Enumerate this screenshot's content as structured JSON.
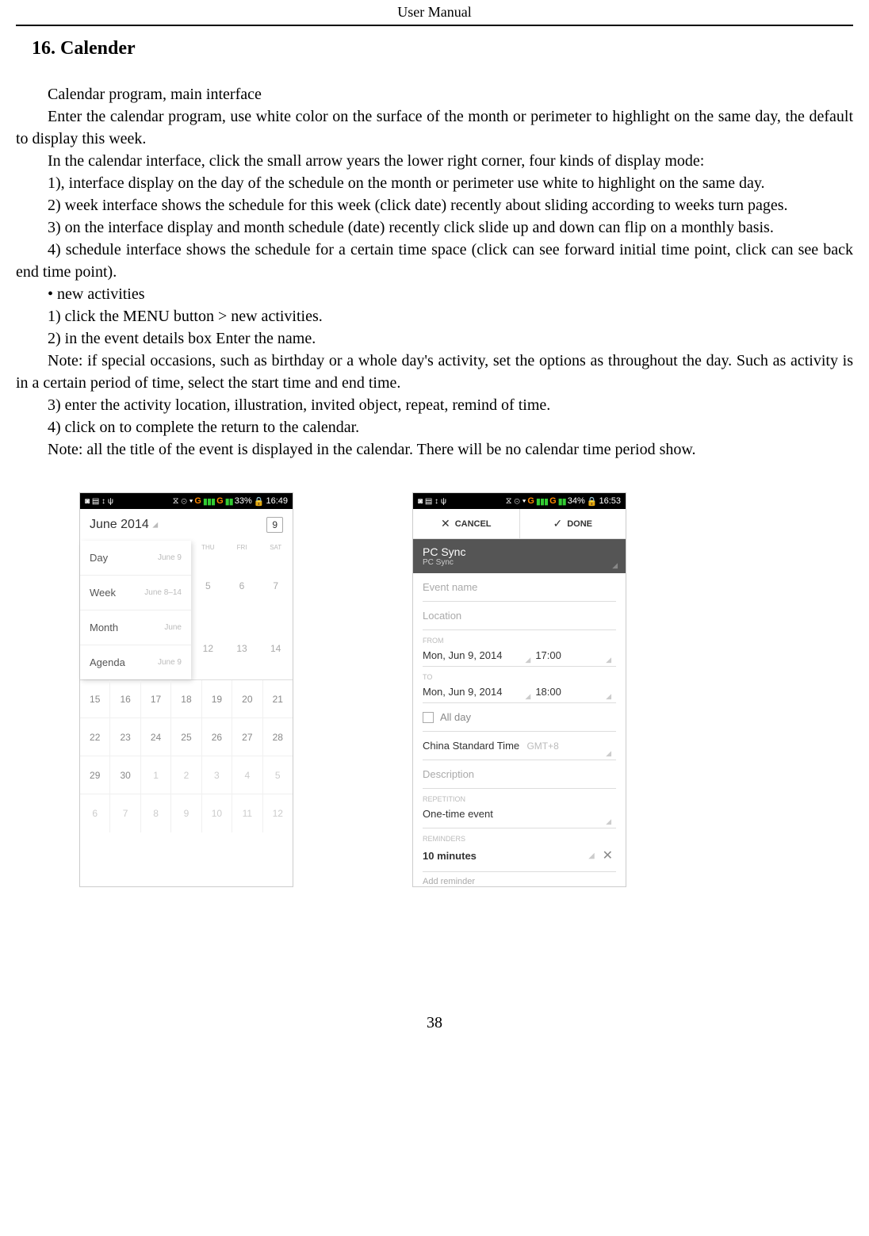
{
  "header_top": "User    Manual",
  "heading": "16. Calender",
  "paragraphs": [
    "Calendar program, main interface",
    "Enter the calendar program, use white color on the surface of the month or perimeter to highlight on the same day, the default to display this week.",
    "In the calendar interface, click the small arrow years the lower right corner, four kinds of display mode:",
    "1), interface display on the day of the schedule on the month or perimeter use white to highlight on the same day.",
    "2) week interface shows the schedule for this week (click date) recently about sliding according to weeks turn pages.",
    "3) on the interface display and month schedule (date) recently click slide up and down can flip on a monthly basis.",
    "4) schedule interface shows the schedule for a certain time space (click can see forward initial time point, click can see back end time point).",
    "• new activities",
    "1) click the MENU button > new activities.",
    "2) in the event details box Enter the name.",
    "Note: if special occasions, such as birthday or a whole day's activity, set the options as throughout the day. Such as activity is in a certain period of time, select the start time and end time.",
    "3) enter the activity location, illustration, invited object, repeat, remind of time.",
    "4) click on to complete the return to the calendar.",
    "Note: all the title of the event is displayed in the calendar. There will be no calendar time period show."
  ],
  "page_number": "38",
  "phone1": {
    "status": {
      "battery": "33%",
      "time": "16:49",
      "g": "G"
    },
    "month_title": "June 2014",
    "today_icon": "9",
    "modes": [
      {
        "label": "Day",
        "val": "June 9"
      },
      {
        "label": "Week",
        "val": "June 8–14"
      },
      {
        "label": "Month",
        "val": "June"
      },
      {
        "label": "Agenda",
        "val": "June 9"
      }
    ],
    "dayhead": [
      "THU",
      "FRI",
      "SAT"
    ],
    "upper_rows": [
      [
        "5",
        "6",
        "7"
      ],
      [
        "12",
        "13",
        "14"
      ]
    ],
    "weeks": [
      [
        {
          "n": "15"
        },
        {
          "n": "16"
        },
        {
          "n": "17"
        },
        {
          "n": "18"
        },
        {
          "n": "19"
        },
        {
          "n": "20"
        },
        {
          "n": "21"
        }
      ],
      [
        {
          "n": "22"
        },
        {
          "n": "23"
        },
        {
          "n": "24"
        },
        {
          "n": "25"
        },
        {
          "n": "26"
        },
        {
          "n": "27"
        },
        {
          "n": "28"
        }
      ],
      [
        {
          "n": "29"
        },
        {
          "n": "30"
        },
        {
          "n": "1",
          "g": true
        },
        {
          "n": "2",
          "g": true
        },
        {
          "n": "3",
          "g": true
        },
        {
          "n": "4",
          "g": true
        },
        {
          "n": "5",
          "g": true
        }
      ],
      [
        {
          "n": "6",
          "g": true
        },
        {
          "n": "7",
          "g": true
        },
        {
          "n": "8",
          "g": true
        },
        {
          "n": "9",
          "g": true
        },
        {
          "n": "10",
          "g": true
        },
        {
          "n": "11",
          "g": true
        },
        {
          "n": "12",
          "g": true
        }
      ]
    ]
  },
  "phone2": {
    "status": {
      "battery": "34%",
      "time": "16:53",
      "g": "G"
    },
    "actions": {
      "cancel": "CANCEL",
      "done": "DONE"
    },
    "sync": {
      "title": "PC Sync",
      "sub": "PC Sync"
    },
    "event_name_placeholder": "Event name",
    "location_placeholder": "Location",
    "from_label": "FROM",
    "from_date": "Mon, Jun 9, 2014",
    "from_time": "17:00",
    "to_label": "TO",
    "to_date": "Mon, Jun 9, 2014",
    "to_time": "18:00",
    "allday": "All day",
    "tz_name": "China Standard Time",
    "tz_offset": "GMT+8",
    "description_placeholder": "Description",
    "repetition_label": "REPETITION",
    "repetition_val": "One-time event",
    "reminders_label": "REMINDERS",
    "reminders_val": "10 minutes",
    "add_reminder": "Add reminder"
  }
}
